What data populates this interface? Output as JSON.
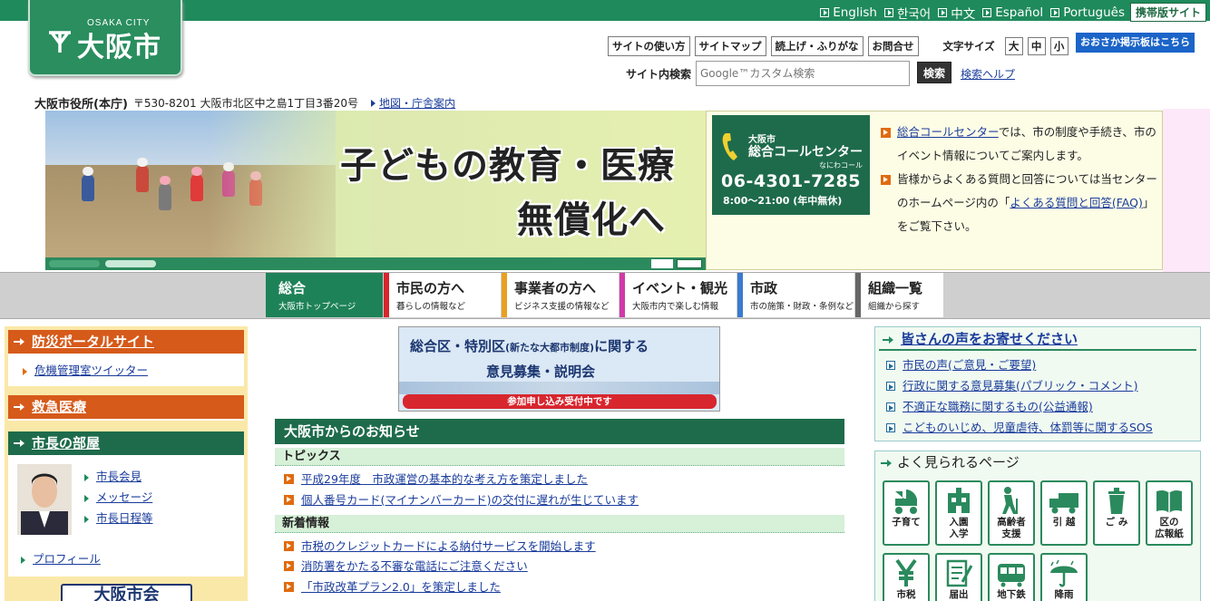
{
  "header": {
    "logo_city_en": "OSAKA CITY",
    "logo_city_jp": "大阪市",
    "languages": [
      "English",
      "한국어",
      "中文",
      "Español",
      "Português"
    ],
    "mobile_site": "携帯版サイト",
    "util_buttons": [
      "サイトの使い方",
      "サイトマップ",
      "読上げ・ふりがな",
      "お問合せ"
    ],
    "font_size_label": "文字サイズ",
    "font_sizes": [
      "大",
      "中",
      "小"
    ],
    "board_button": "おおさか掲示板はこちら",
    "search_label": "サイト内検索",
    "search_placeholder": "Google™カスタム検索",
    "search_button": "検索",
    "search_help": "検索ヘルプ"
  },
  "address": {
    "name": "大阪市役所(本庁)",
    "text": "〒530-8201 大阪市北区中之島1丁目3番20号",
    "map_link": "地図・庁舎案内"
  },
  "slideshow": {
    "line1": "子どもの教育・医療",
    "line2": "無償化へ"
  },
  "call_center": {
    "line1": "大阪市",
    "line2": "総合コールセンター",
    "kana": "なにわコール",
    "number": "06-4301-7285",
    "hours": "8:00～21:00 (年中無休)",
    "info1_link": "総合コールセンター",
    "info1_text": "では、市の制度や手続き、市のイベント情報についてご案内します。",
    "info2_text_a": "皆様からよくある質問と回答については当センターのホームページ内の「",
    "info2_link": "よくある質問と回答(FAQ)",
    "info2_text_b": "」をご覧下さい。"
  },
  "nav": {
    "tabs": [
      {
        "title": "総合",
        "sub": "大阪市トップページ",
        "color": "#1e8258"
      },
      {
        "title": "市民の方へ",
        "sub": "暮らしの情報など",
        "color": "#d8262e"
      },
      {
        "title": "事業者の方へ",
        "sub": "ビジネス支援の情報など",
        "color": "#e8a020"
      },
      {
        "title": "イベント・観光",
        "sub": "大阪市内で楽しむ情報",
        "color": "#d03aa8"
      },
      {
        "title": "市政",
        "sub": "市の施策・財政・条例など",
        "color": "#3a7ad0"
      },
      {
        "title": "組織一覧",
        "sub": "組織から探す",
        "color": "#666666"
      }
    ]
  },
  "left": {
    "bousai_title": "防災ポータルサイト",
    "bousai_sub": "危機管理室ツイッター",
    "kyukyu_title": "救急医療",
    "mayor_title": "市長の部屋",
    "mayor_links": [
      "市長会見",
      "メッセージ",
      "市長日程等"
    ],
    "profile": "プロフィール",
    "bottom_logo": "大阪市会"
  },
  "middle": {
    "banner_line1a": "総合区・特別区",
    "banner_line1b": "(新たな大都市制度)",
    "banner_line1c": "に関する",
    "banner_line2": "意見募集・説明会",
    "banner_red": "参加申し込み受付中です",
    "news_title": "大阪市からのお知らせ",
    "topics_label": "トピックス",
    "topics": [
      "平成29年度　市政運営の基本的な考え方を策定しました",
      "個人番号カード(マイナンバーカード)の交付に遅れが生じています"
    ],
    "new_label": "新着情報",
    "new_items": [
      "市税のクレジットカードによる納付サービスを開始します",
      "消防署をかたる不審な電話にご注意ください",
      "「市政改革プラン2.0」を策定しました"
    ]
  },
  "right": {
    "voice_title": "皆さんの声をお寄せください",
    "voice_links": [
      "市民の声(ご意見・ご要望)",
      "行政に関する意見募集(パブリック・コメント)",
      "不適正な職務に関するもの(公益通報)",
      "こどものいじめ、児童虐待、体罰等に関するSOS"
    ],
    "popular_title": "よく見られるページ",
    "tiles": [
      "子育て",
      "入園\n入学",
      "高齢者\n支援",
      "引 越",
      "ご み",
      "区の\n広報紙",
      "市税",
      "届出",
      "地下鉄",
      "降雨"
    ]
  },
  "colors": {
    "brand_green": "#1f8a5c",
    "dark_green": "#1e6b4b",
    "accent_orange": "#e06b10",
    "link_blue": "#1a3c9c"
  }
}
